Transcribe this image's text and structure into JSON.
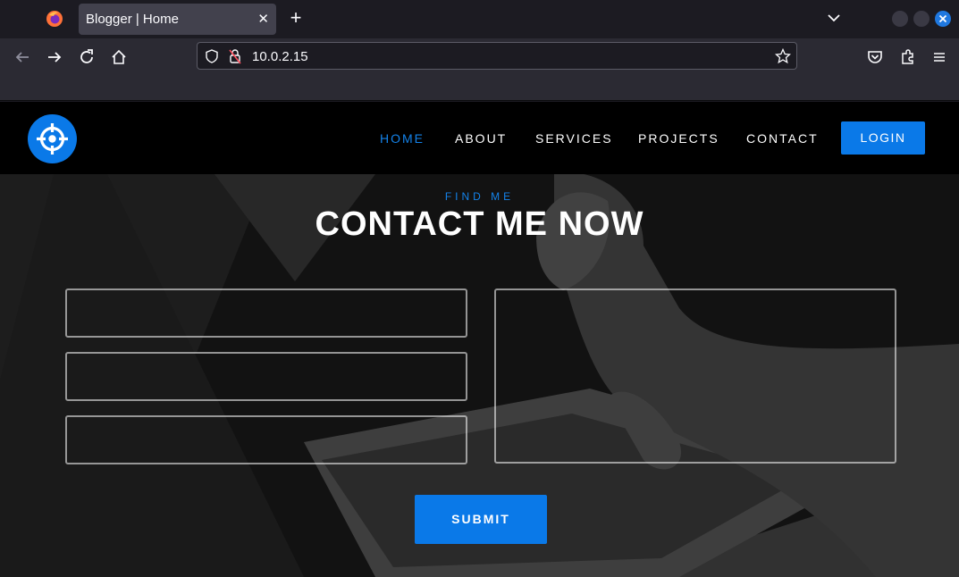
{
  "browser": {
    "tab": {
      "title": "Blogger | Home",
      "close_glyph": "✕"
    },
    "new_tab_glyph": "+",
    "url": "10.0.2.15",
    "accent": "#1f78e0"
  },
  "site": {
    "nav": {
      "home": "HOME",
      "about": "ABOUT",
      "services": "SERVICES",
      "projects": "PROJECTS",
      "contact": "CONTACT",
      "login": "LOGIN"
    },
    "eyebrow": "FIND ME",
    "heading": "CONTACT ME NOW",
    "form": {
      "name_value": "",
      "email_value": "",
      "subject_value": "",
      "message_value": "",
      "submit": "SUBMIT"
    },
    "colors": {
      "brand": "#0a79e8",
      "header_bg": "#000000"
    }
  }
}
